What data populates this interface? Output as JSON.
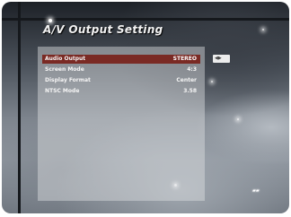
{
  "menu": {
    "title": "A/V Output Setting",
    "items": [
      {
        "label": "Audio Output",
        "value": "STEREO",
        "selected": true
      },
      {
        "label": "Screen Mode",
        "value": "4:3",
        "selected": false
      },
      {
        "label": "Display Format",
        "value": "Center",
        "selected": false
      },
      {
        "label": "NTSC Mode",
        "value": "3.58",
        "selected": false
      }
    ]
  },
  "side_chip": {
    "icon": "remote-button-icon",
    "text": "◀▶"
  },
  "corner_logo": {
    "icon": "brand-logo-icon",
    "text": "▰▰"
  }
}
